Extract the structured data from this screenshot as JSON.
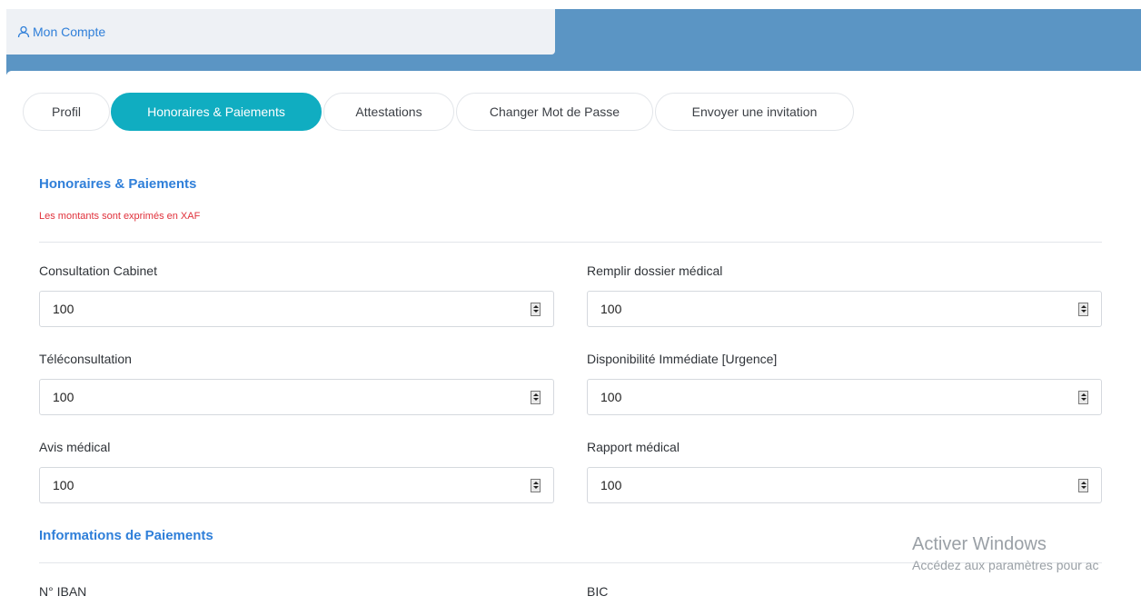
{
  "breadcrumb": {
    "label": "Mon Compte",
    "icon": "user-icon"
  },
  "tabs": [
    {
      "label": "Profil",
      "active": false
    },
    {
      "label": "Honoraires & Paiements",
      "active": true
    },
    {
      "label": "Attestations",
      "active": false
    },
    {
      "label": "Changer Mot de Passe",
      "active": false
    },
    {
      "label": "Envoyer une invitation",
      "active": false
    }
  ],
  "fees": {
    "title": "Honoraires & Paiements",
    "note": "Les montants sont exprimés en XAF",
    "fields": [
      {
        "label": "Consultation Cabinet",
        "value": "100"
      },
      {
        "label": "Remplir dossier médical",
        "value": "100"
      },
      {
        "label": "Téléconsultation",
        "value": "100"
      },
      {
        "label": "Disponibilité Immédiate [Urgence]",
        "value": "100"
      },
      {
        "label": "Avis médical",
        "value": "100"
      },
      {
        "label": "Rapport médical",
        "value": "100"
      }
    ]
  },
  "payment": {
    "title": "Informations de Paiements",
    "iban_label": "N° IBAN",
    "bic_label": "BIC"
  },
  "watermark": {
    "line1": "Activer Windows",
    "line2": "Accédez aux paramètres pour ac"
  },
  "colors": {
    "header": "#5b95c4",
    "accent": "#10adc1",
    "link": "#2f7fd9",
    "note": "#e0313b"
  }
}
